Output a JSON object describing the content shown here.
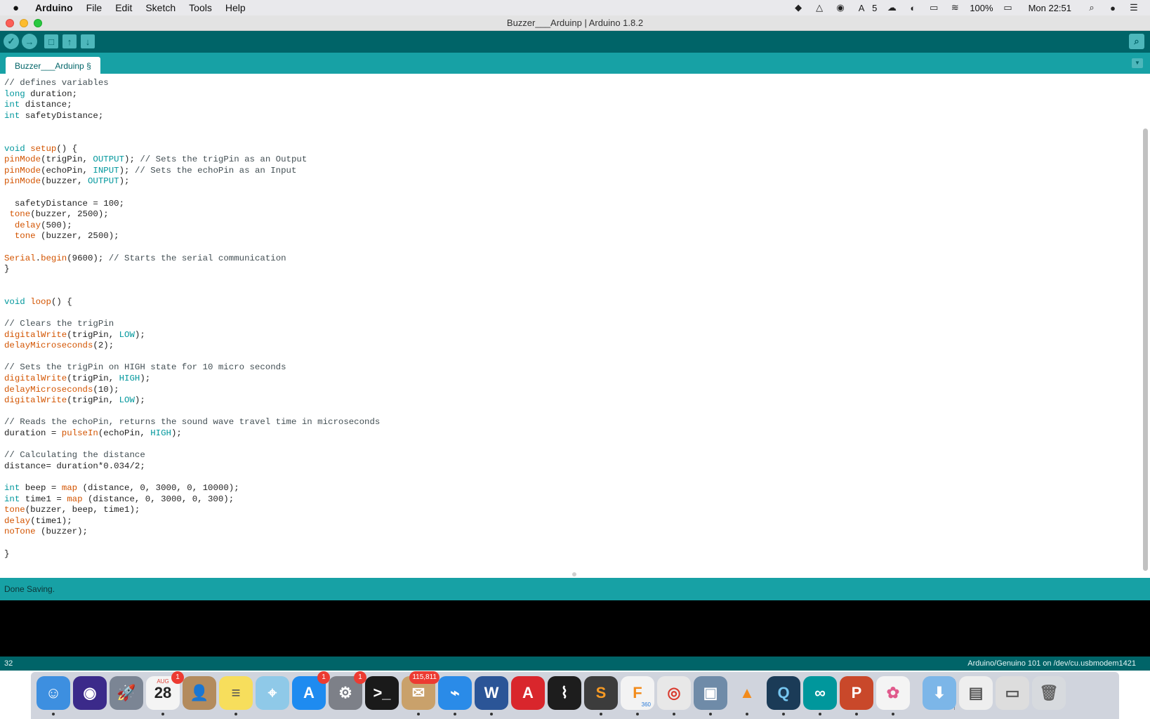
{
  "menubar": {
    "apple_icon": "apple-icon",
    "app_name": "Arduino",
    "items": [
      "File",
      "Edit",
      "Sketch",
      "Tools",
      "Help"
    ],
    "tray": {
      "notification_count": "5",
      "battery": "100%",
      "clock": "Mon 22:51"
    }
  },
  "window": {
    "title": "Buzzer___Arduinp | Arduino 1.8.2"
  },
  "toolbar": {
    "verify_icon": "✓",
    "upload_icon": "→",
    "new_icon": "□",
    "open_icon": "↑",
    "save_icon": "↓",
    "serial_icon": "⌕"
  },
  "tabs": [
    {
      "label": "Buzzer___Arduinp §"
    }
  ],
  "tab_menu_icon": "▼",
  "code_lines": [
    [
      [
        "cm",
        "// defines variables"
      ]
    ],
    [
      [
        "kw",
        "long"
      ],
      [
        "",
        " duration;"
      ]
    ],
    [
      [
        "kw",
        "int"
      ],
      [
        "",
        " distance;"
      ]
    ],
    [
      [
        "kw",
        "int"
      ],
      [
        "",
        " safetyDistance;"
      ]
    ],
    [
      [
        "",
        ""
      ]
    ],
    [
      [
        "",
        ""
      ]
    ],
    [
      [
        "kw",
        "void"
      ],
      [
        "",
        " "
      ],
      [
        "fn",
        "setup"
      ],
      [
        "",
        "() {"
      ]
    ],
    [
      [
        "fn",
        "pinMode"
      ],
      [
        "",
        "(trigPin, "
      ],
      [
        "lit",
        "OUTPUT"
      ],
      [
        "",
        "); "
      ],
      [
        "cm",
        "// Sets the trigPin as an Output"
      ]
    ],
    [
      [
        "fn",
        "pinMode"
      ],
      [
        "",
        "(echoPin, "
      ],
      [
        "lit",
        "INPUT"
      ],
      [
        "",
        "); "
      ],
      [
        "cm",
        "// Sets the echoPin as an Input"
      ]
    ],
    [
      [
        "fn",
        "pinMode"
      ],
      [
        "",
        "(buzzer, "
      ],
      [
        "lit",
        "OUTPUT"
      ],
      [
        "",
        ");"
      ]
    ],
    [
      [
        "",
        ""
      ]
    ],
    [
      [
        "",
        "  safetyDistance = 100;"
      ]
    ],
    [
      [
        "",
        " "
      ],
      [
        "fn",
        "tone"
      ],
      [
        "",
        "(buzzer, 2500);"
      ]
    ],
    [
      [
        "",
        "  "
      ],
      [
        "fn",
        "delay"
      ],
      [
        "",
        "(500);"
      ]
    ],
    [
      [
        "",
        "  "
      ],
      [
        "fn",
        "tone"
      ],
      [
        "",
        " (buzzer, 2500);"
      ]
    ],
    [
      [
        "",
        ""
      ]
    ],
    [
      [
        "fn",
        "Serial"
      ],
      [
        "",
        "."
      ],
      [
        "fn",
        "begin"
      ],
      [
        "",
        "(9600); "
      ],
      [
        "cm",
        "// Starts the serial communication"
      ]
    ],
    [
      [
        "",
        "}"
      ]
    ],
    [
      [
        "",
        ""
      ]
    ],
    [
      [
        "",
        ""
      ]
    ],
    [
      [
        "kw",
        "void"
      ],
      [
        "",
        " "
      ],
      [
        "fn",
        "loop"
      ],
      [
        "",
        "() {"
      ]
    ],
    [
      [
        "",
        ""
      ]
    ],
    [
      [
        "cm",
        "// Clears the trigPin"
      ]
    ],
    [
      [
        "fn",
        "digitalWrite"
      ],
      [
        "",
        "(trigPin, "
      ],
      [
        "lit",
        "LOW"
      ],
      [
        "",
        ");"
      ]
    ],
    [
      [
        "fn",
        "delayMicroseconds"
      ],
      [
        "",
        "(2);"
      ]
    ],
    [
      [
        "",
        ""
      ]
    ],
    [
      [
        "cm",
        "// Sets the trigPin on HIGH state for 10 micro seconds"
      ]
    ],
    [
      [
        "fn",
        "digitalWrite"
      ],
      [
        "",
        "(trigPin, "
      ],
      [
        "lit",
        "HIGH"
      ],
      [
        "",
        ");"
      ]
    ],
    [
      [
        "fn",
        "delayMicroseconds"
      ],
      [
        "",
        "(10);"
      ]
    ],
    [
      [
        "fn",
        "digitalWrite"
      ],
      [
        "",
        "(trigPin, "
      ],
      [
        "lit",
        "LOW"
      ],
      [
        "",
        ");"
      ]
    ],
    [
      [
        "",
        ""
      ]
    ],
    [
      [
        "cm",
        "// Reads the echoPin, returns the sound wave travel time in microseconds"
      ]
    ],
    [
      [
        "",
        "duration = "
      ],
      [
        "fn",
        "pulseIn"
      ],
      [
        "",
        "(echoPin, "
      ],
      [
        "lit",
        "HIGH"
      ],
      [
        "",
        ");"
      ]
    ],
    [
      [
        "",
        ""
      ]
    ],
    [
      [
        "cm",
        "// Calculating the distance"
      ]
    ],
    [
      [
        "",
        "distance= duration*0.034/2;"
      ]
    ],
    [
      [
        "",
        ""
      ]
    ],
    [
      [
        "kw",
        "int"
      ],
      [
        "",
        " beep = "
      ],
      [
        "fn",
        "map"
      ],
      [
        "",
        " (distance, 0, 3000, 0, 10000);"
      ]
    ],
    [
      [
        "kw",
        "int"
      ],
      [
        "",
        " time1 = "
      ],
      [
        "fn",
        "map"
      ],
      [
        "",
        " (distance, 0, 3000, 0, 300);"
      ]
    ],
    [
      [
        "fn",
        "tone"
      ],
      [
        "",
        "(buzzer, beep, time1);"
      ]
    ],
    [
      [
        "fn",
        "delay"
      ],
      [
        "",
        "(time1);"
      ]
    ],
    [
      [
        "fn",
        "noTone"
      ],
      [
        "",
        " (buzzer);"
      ]
    ],
    [
      [
        "",
        ""
      ]
    ],
    [
      [
        "",
        "}"
      ]
    ]
  ],
  "status": {
    "message": "Done Saving."
  },
  "footer": {
    "line_number": "32",
    "board_port": "Arduino/Genuino 101 on /dev/cu.usbmodem1421"
  },
  "dock": {
    "items": [
      {
        "name": "finder-icon",
        "glyph": "☺",
        "bg": "#3d8fe0",
        "running": true
      },
      {
        "name": "siri-icon",
        "glyph": "◉",
        "bg": "#3b2a8a",
        "running": false
      },
      {
        "name": "launchpad-icon",
        "glyph": "🚀",
        "bg": "#7b8594",
        "running": false
      },
      {
        "name": "calendar-icon",
        "glyph": "28",
        "bg": "#f4f4f4",
        "fg": "#222",
        "badge": "1",
        "running": true,
        "caption": "AUG"
      },
      {
        "name": "contacts-icon",
        "glyph": "👤",
        "bg": "#b38b5d",
        "running": false
      },
      {
        "name": "notes-icon",
        "glyph": "≡",
        "bg": "#f7de5c",
        "fg": "#555",
        "running": true
      },
      {
        "name": "maps-icon",
        "glyph": "⌖",
        "bg": "#8fc9e8",
        "running": false
      },
      {
        "name": "app-store-icon",
        "glyph": "A",
        "bg": "#1e8bf0",
        "badge": "1",
        "running": false
      },
      {
        "name": "system-preferences-icon",
        "glyph": "⚙",
        "bg": "#7d8088",
        "badge": "1",
        "running": false
      },
      {
        "name": "terminal-icon",
        "glyph": ">_",
        "bg": "#1a1a1a",
        "running": false
      },
      {
        "name": "mail-icon",
        "glyph": "✉",
        "bg": "#c9a16b",
        "badge": "115,811",
        "running": true
      },
      {
        "name": "safari-icon",
        "glyph": "⌁",
        "bg": "#2a8be8",
        "running": true
      },
      {
        "name": "word-icon",
        "glyph": "W",
        "bg": "#2b5597",
        "running": true
      },
      {
        "name": "autocad-icon",
        "glyph": "A",
        "bg": "#d9262c",
        "running": false
      },
      {
        "name": "acrobat-icon",
        "glyph": "⌇",
        "bg": "#1d1d1d",
        "running": false
      },
      {
        "name": "sublime-text-icon",
        "glyph": "S",
        "bg": "#3c3c3c",
        "fg": "#f79a24",
        "running": true
      },
      {
        "name": "fusion-360-icon",
        "glyph": "F",
        "bg": "#f3f3f3",
        "fg": "#f28b1b",
        "running": true,
        "caption": "360"
      },
      {
        "name": "chrome-icon",
        "glyph": "◎",
        "bg": "#e8e8e8",
        "fg": "#d93b2f",
        "running": true
      },
      {
        "name": "preview-icon",
        "glyph": "▣",
        "bg": "#6f8ba8",
        "running": true
      },
      {
        "name": "vlc-icon",
        "glyph": "▲",
        "bg": "transparent",
        "fg": "#f28b1b",
        "running": true
      },
      {
        "name": "quicktime-icon",
        "glyph": "Q",
        "bg": "#1b3b57",
        "fg": "#76c6f0",
        "running": true
      },
      {
        "name": "arduino-icon",
        "glyph": "∞",
        "bg": "#00979c",
        "running": true
      },
      {
        "name": "powerpoint-icon",
        "glyph": "P",
        "bg": "#c9482a",
        "running": true
      },
      {
        "name": "photos-icon",
        "glyph": "✿",
        "bg": "#f4f4f4",
        "fg": "#e05a8c",
        "running": true
      },
      {
        "name": "downloads-folder-icon",
        "glyph": "⬇",
        "bg": "#7cb6e8",
        "running": false
      },
      {
        "name": "document-stack-icon",
        "glyph": "▤",
        "bg": "#eeeeee",
        "fg": "#555",
        "running": false
      },
      {
        "name": "screenshot-stack-icon",
        "glyph": "▭",
        "bg": "#dddddd",
        "fg": "#555",
        "running": false
      },
      {
        "name": "trash-icon",
        "glyph": "🗑",
        "bg": "#d7dade",
        "fg": "#666",
        "running": false
      }
    ]
  }
}
